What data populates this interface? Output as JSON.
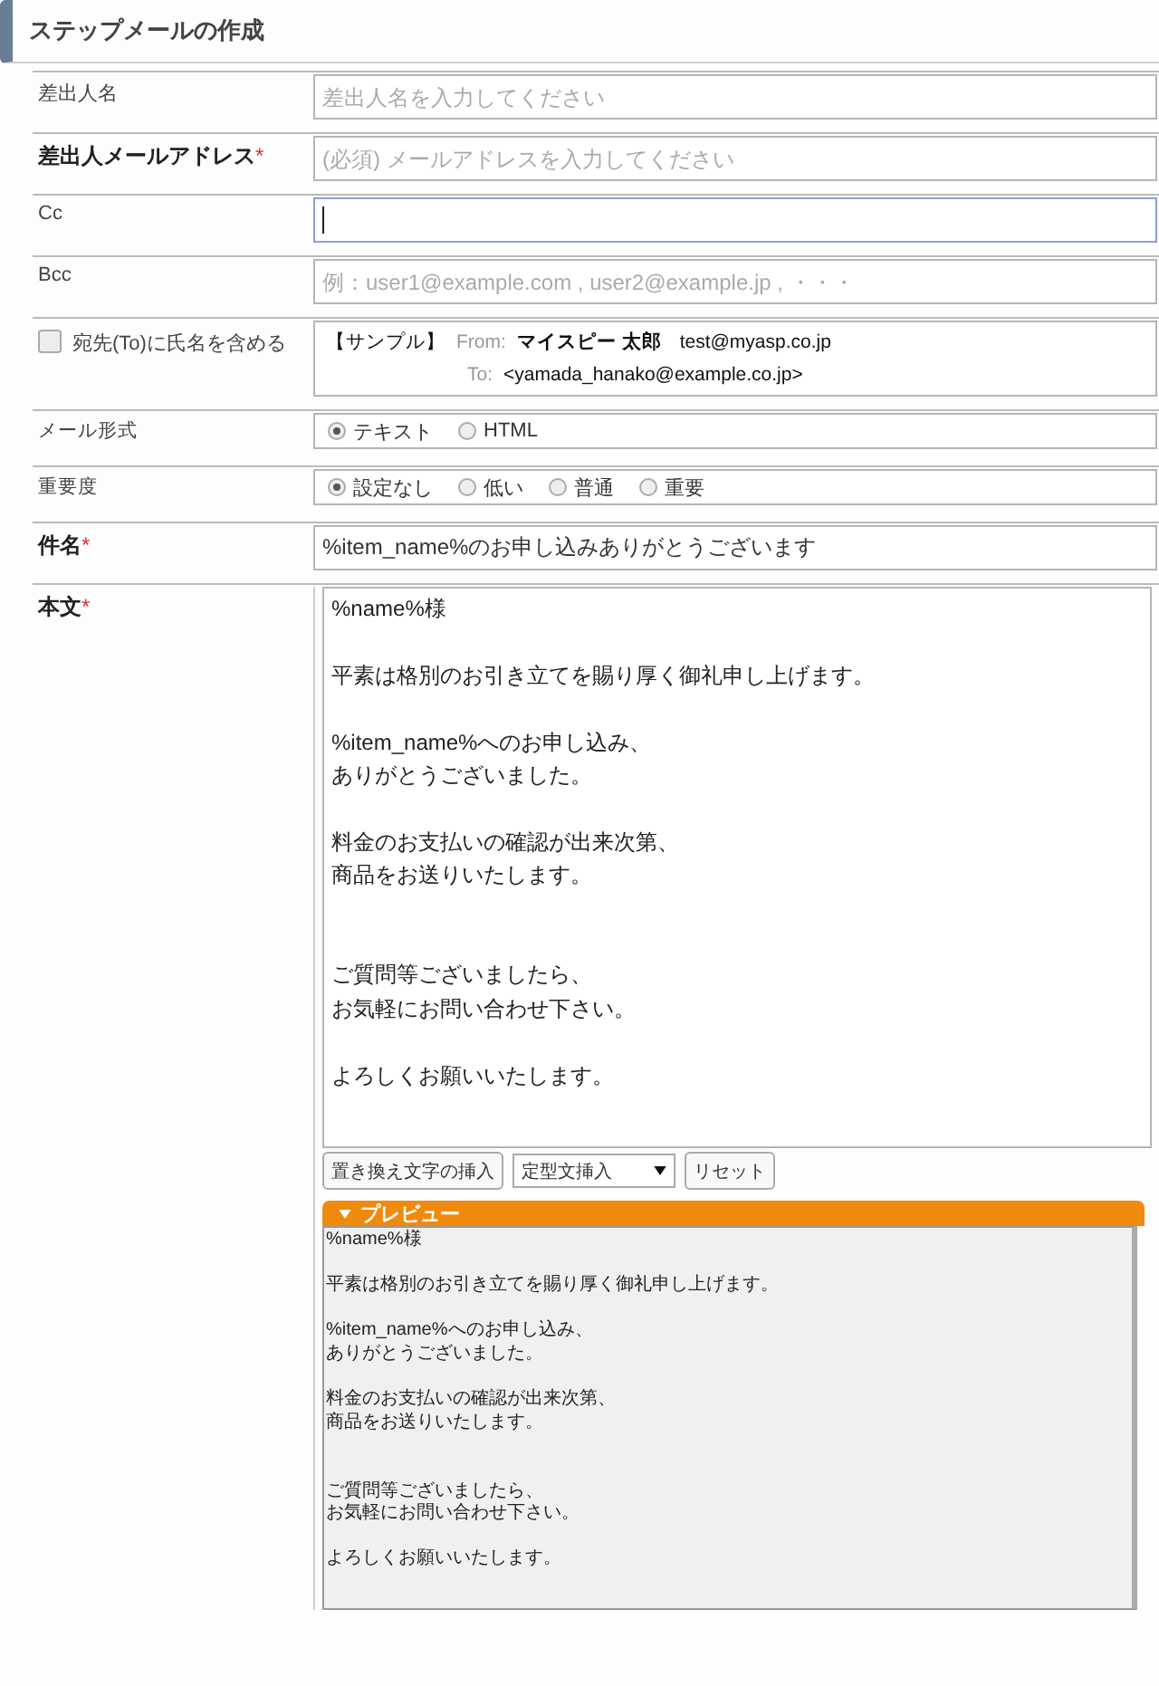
{
  "header": {
    "title": "ステップメールの作成"
  },
  "sender_name": {
    "label": "差出人名",
    "placeholder": "差出人名を入力してください"
  },
  "sender_address": {
    "label": "差出人メールアドレス",
    "required_mark": "*",
    "placeholder": "(必須) メールアドレスを入力してください"
  },
  "cc": {
    "label": "Cc",
    "focused": true
  },
  "bcc": {
    "label": "Bcc",
    "placeholder": "例：user1@example.com , user2@example.jp , ・・・"
  },
  "include_name": {
    "label": "宛先(To)に氏名を含める",
    "checked": false,
    "sample": {
      "tag": "【サンプル】",
      "from_label": "From:",
      "from_name": "マイスピー 太郎",
      "from_address": "test@myasp.co.jp",
      "to_label": "To:",
      "to_address": "<yamada_hanako@example.co.jp>"
    }
  },
  "mail_format": {
    "label": "メール形式",
    "options": [
      {
        "label": "テキスト",
        "selected": true
      },
      {
        "label": "HTML",
        "selected": false
      }
    ]
  },
  "importance": {
    "label": "重要度",
    "options": [
      {
        "label": "設定なし",
        "selected": true
      },
      {
        "label": "低い",
        "selected": false
      },
      {
        "label": "普通",
        "selected": false
      },
      {
        "label": "重要",
        "selected": false
      }
    ]
  },
  "subject": {
    "label": "件名",
    "required_mark": "*",
    "value": "%item_name%のお申し込みありがとうございます"
  },
  "body": {
    "label": "本文",
    "required_mark": "*",
    "paragraphs": [
      {
        "lines": [
          "%name%様"
        ],
        "wide_gap": false
      },
      {
        "lines": [
          "平素は格別のお引き立てを賜り厚く御礼申し上げます。"
        ],
        "wide_gap": false
      },
      {
        "lines": [
          "%item_name%へのお申し込み、",
          "ありがとうございました。"
        ],
        "wide_gap": false
      },
      {
        "lines": [
          "料金のお支払いの確認が出来次第、",
          "商品をお送りいたします。"
        ],
        "wide_gap": false
      },
      {
        "lines": [
          "ご質問等ございましたら、",
          "お気軽にお問い合わせ下さい。"
        ],
        "wide_gap": true
      },
      {
        "lines": [
          "よろしくお願いいたします。"
        ],
        "wide_gap": false
      }
    ],
    "insert_button": "置き換え文字の挿入",
    "template_select": "定型文挿入",
    "reset_button": "リセット"
  },
  "preview": {
    "title": "プレビュー",
    "expanded": true,
    "paragraphs": [
      {
        "lines": [
          "%name%様"
        ],
        "wide_gap": false
      },
      {
        "lines": [
          "平素は格別のお引き立てを賜り厚く御礼申し上げます。"
        ],
        "wide_gap": false
      },
      {
        "lines": [
          "%item_name%へのお申し込み、",
          "ありがとうございました。"
        ],
        "wide_gap": false
      },
      {
        "lines": [
          "料金のお支払いの確認が出来次第、",
          "商品をお送りいたします。"
        ],
        "wide_gap": false
      },
      {
        "lines": [
          "ご質問等ございましたら、",
          "お気軽にお問い合わせ下さい。"
        ],
        "wide_gap": true
      },
      {
        "lines": [
          "よろしくお願いいたします。"
        ],
        "wide_gap": false
      }
    ]
  }
}
